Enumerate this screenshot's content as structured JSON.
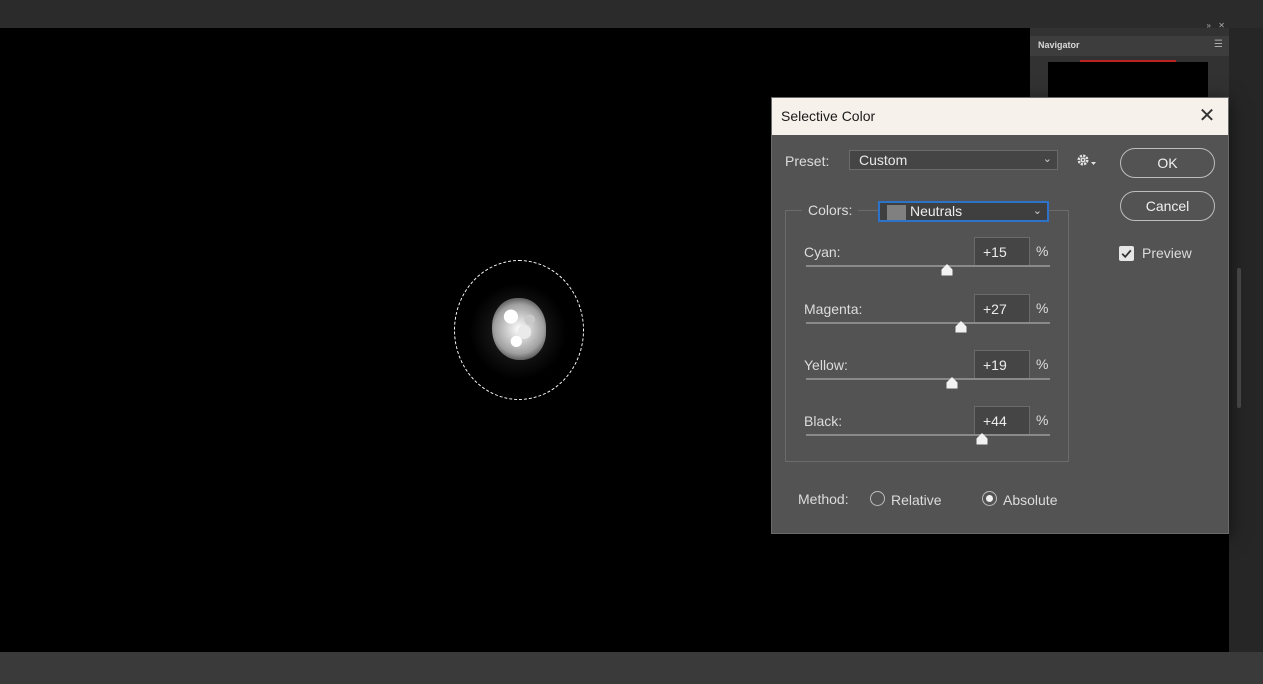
{
  "navigator": {
    "title": "Navigator"
  },
  "dialog": {
    "title": "Selective Color",
    "preset_label": "Preset:",
    "preset_value": "Custom",
    "ok_label": "OK",
    "cancel_label": "Cancel",
    "preview_label": "Preview",
    "preview_checked": true,
    "colors_label": "Colors:",
    "colors_value": "Neutrals",
    "colors_swatch": "#808080",
    "sliders": [
      {
        "label": "Cyan:",
        "value": "+15",
        "unit": "%"
      },
      {
        "label": "Magenta:",
        "value": "+27",
        "unit": "%"
      },
      {
        "label": "Yellow:",
        "value": "+19",
        "unit": "%"
      },
      {
        "label": "Black:",
        "value": "+44",
        "unit": "%"
      }
    ],
    "method_label": "Method:",
    "method_options": [
      "Relative",
      "Absolute"
    ],
    "method_selected": "Absolute"
  },
  "colors": {
    "accent": "#2d73c9",
    "title_bar": "#f7f1ec",
    "dialog_bg": "#535353",
    "canvas": "#000000"
  },
  "icons": {
    "close": "close-icon",
    "gear": "gear-icon",
    "check": "checkmark-icon",
    "chevron": "chevron-down-icon"
  }
}
